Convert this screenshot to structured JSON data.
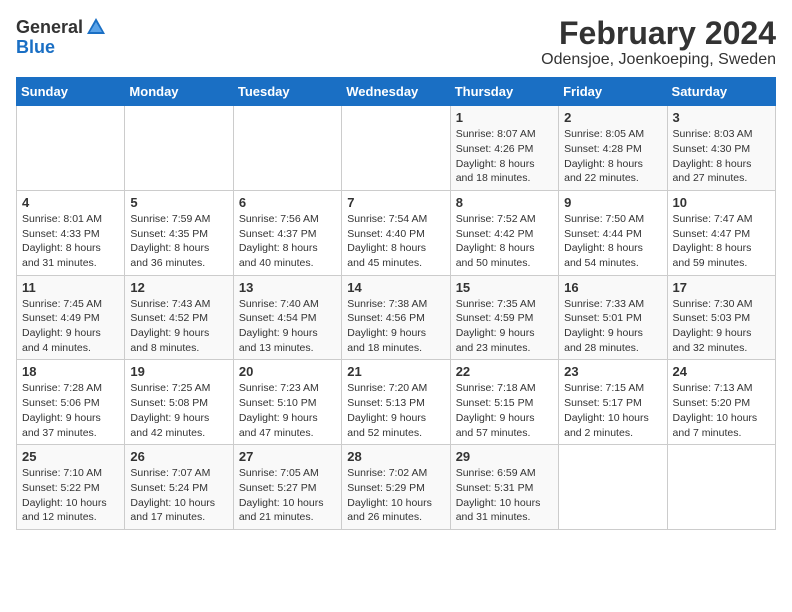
{
  "header": {
    "logo_general": "General",
    "logo_blue": "Blue",
    "month_title": "February 2024",
    "location": "Odensjoe, Joenkoeping, Sweden"
  },
  "calendar": {
    "weekdays": [
      "Sunday",
      "Monday",
      "Tuesday",
      "Wednesday",
      "Thursday",
      "Friday",
      "Saturday"
    ],
    "weeks": [
      [
        {
          "day": "",
          "info": ""
        },
        {
          "day": "",
          "info": ""
        },
        {
          "day": "",
          "info": ""
        },
        {
          "day": "",
          "info": ""
        },
        {
          "day": "1",
          "info": "Sunrise: 8:07 AM\nSunset: 4:26 PM\nDaylight: 8 hours\nand 18 minutes."
        },
        {
          "day": "2",
          "info": "Sunrise: 8:05 AM\nSunset: 4:28 PM\nDaylight: 8 hours\nand 22 minutes."
        },
        {
          "day": "3",
          "info": "Sunrise: 8:03 AM\nSunset: 4:30 PM\nDaylight: 8 hours\nand 27 minutes."
        }
      ],
      [
        {
          "day": "4",
          "info": "Sunrise: 8:01 AM\nSunset: 4:33 PM\nDaylight: 8 hours\nand 31 minutes."
        },
        {
          "day": "5",
          "info": "Sunrise: 7:59 AM\nSunset: 4:35 PM\nDaylight: 8 hours\nand 36 minutes."
        },
        {
          "day": "6",
          "info": "Sunrise: 7:56 AM\nSunset: 4:37 PM\nDaylight: 8 hours\nand 40 minutes."
        },
        {
          "day": "7",
          "info": "Sunrise: 7:54 AM\nSunset: 4:40 PM\nDaylight: 8 hours\nand 45 minutes."
        },
        {
          "day": "8",
          "info": "Sunrise: 7:52 AM\nSunset: 4:42 PM\nDaylight: 8 hours\nand 50 minutes."
        },
        {
          "day": "9",
          "info": "Sunrise: 7:50 AM\nSunset: 4:44 PM\nDaylight: 8 hours\nand 54 minutes."
        },
        {
          "day": "10",
          "info": "Sunrise: 7:47 AM\nSunset: 4:47 PM\nDaylight: 8 hours\nand 59 minutes."
        }
      ],
      [
        {
          "day": "11",
          "info": "Sunrise: 7:45 AM\nSunset: 4:49 PM\nDaylight: 9 hours\nand 4 minutes."
        },
        {
          "day": "12",
          "info": "Sunrise: 7:43 AM\nSunset: 4:52 PM\nDaylight: 9 hours\nand 8 minutes."
        },
        {
          "day": "13",
          "info": "Sunrise: 7:40 AM\nSunset: 4:54 PM\nDaylight: 9 hours\nand 13 minutes."
        },
        {
          "day": "14",
          "info": "Sunrise: 7:38 AM\nSunset: 4:56 PM\nDaylight: 9 hours\nand 18 minutes."
        },
        {
          "day": "15",
          "info": "Sunrise: 7:35 AM\nSunset: 4:59 PM\nDaylight: 9 hours\nand 23 minutes."
        },
        {
          "day": "16",
          "info": "Sunrise: 7:33 AM\nSunset: 5:01 PM\nDaylight: 9 hours\nand 28 minutes."
        },
        {
          "day": "17",
          "info": "Sunrise: 7:30 AM\nSunset: 5:03 PM\nDaylight: 9 hours\nand 32 minutes."
        }
      ],
      [
        {
          "day": "18",
          "info": "Sunrise: 7:28 AM\nSunset: 5:06 PM\nDaylight: 9 hours\nand 37 minutes."
        },
        {
          "day": "19",
          "info": "Sunrise: 7:25 AM\nSunset: 5:08 PM\nDaylight: 9 hours\nand 42 minutes."
        },
        {
          "day": "20",
          "info": "Sunrise: 7:23 AM\nSunset: 5:10 PM\nDaylight: 9 hours\nand 47 minutes."
        },
        {
          "day": "21",
          "info": "Sunrise: 7:20 AM\nSunset: 5:13 PM\nDaylight: 9 hours\nand 52 minutes."
        },
        {
          "day": "22",
          "info": "Sunrise: 7:18 AM\nSunset: 5:15 PM\nDaylight: 9 hours\nand 57 minutes."
        },
        {
          "day": "23",
          "info": "Sunrise: 7:15 AM\nSunset: 5:17 PM\nDaylight: 10 hours\nand 2 minutes."
        },
        {
          "day": "24",
          "info": "Sunrise: 7:13 AM\nSunset: 5:20 PM\nDaylight: 10 hours\nand 7 minutes."
        }
      ],
      [
        {
          "day": "25",
          "info": "Sunrise: 7:10 AM\nSunset: 5:22 PM\nDaylight: 10 hours\nand 12 minutes."
        },
        {
          "day": "26",
          "info": "Sunrise: 7:07 AM\nSunset: 5:24 PM\nDaylight: 10 hours\nand 17 minutes."
        },
        {
          "day": "27",
          "info": "Sunrise: 7:05 AM\nSunset: 5:27 PM\nDaylight: 10 hours\nand 21 minutes."
        },
        {
          "day": "28",
          "info": "Sunrise: 7:02 AM\nSunset: 5:29 PM\nDaylight: 10 hours\nand 26 minutes."
        },
        {
          "day": "29",
          "info": "Sunrise: 6:59 AM\nSunset: 5:31 PM\nDaylight: 10 hours\nand 31 minutes."
        },
        {
          "day": "",
          "info": ""
        },
        {
          "day": "",
          "info": ""
        }
      ]
    ]
  }
}
